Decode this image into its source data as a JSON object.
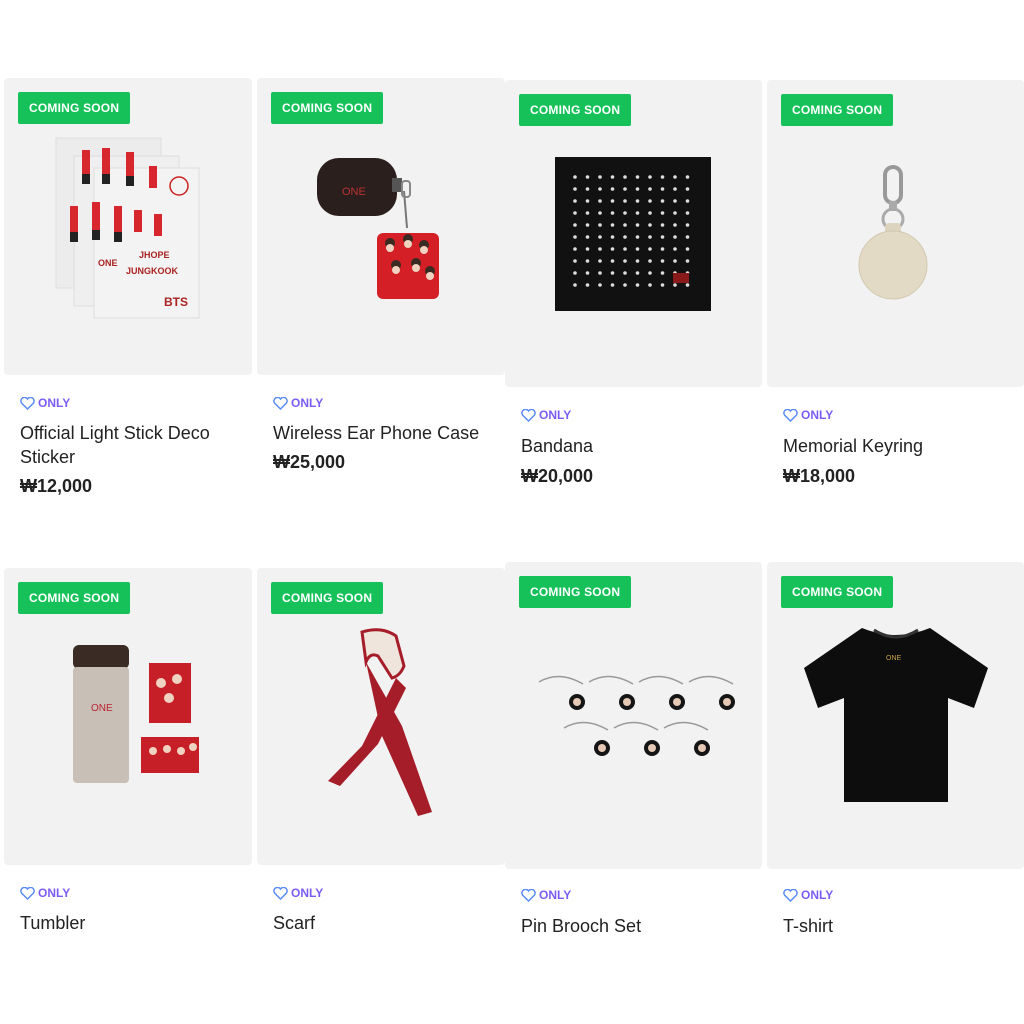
{
  "badge_label": "COMING SOON",
  "only_label": "ONLY",
  "colors": {
    "badge": "#17c15a",
    "only": "#7a5df5",
    "thumb_bg": "#f2f2f2"
  },
  "products": [
    {
      "name": "Official Light Stick Deco Sticker",
      "price": "₩12,000",
      "image": "sticker-sheet-image"
    },
    {
      "name": "Wireless Ear Phone Case",
      "price": "₩25,000",
      "image": "earphone-case-image"
    },
    {
      "name": "Bandana",
      "price": "₩20,000",
      "image": "bandana-image"
    },
    {
      "name": "Memorial Keyring",
      "price": "₩18,000",
      "image": "keyring-image"
    },
    {
      "name": "Tumbler",
      "price": "",
      "image": "tumbler-image"
    },
    {
      "name": "Scarf",
      "price": "",
      "image": "scarf-image"
    },
    {
      "name": "Pin Brooch Set",
      "price": "",
      "image": "pin-brooch-image"
    },
    {
      "name": "T-shirt",
      "price": "",
      "image": "tshirt-image"
    }
  ],
  "art_text": {
    "one_logo": "ONE",
    "sticker_lines": [
      "JHOPE",
      "JUNGKOOK",
      "BTS"
    ]
  }
}
